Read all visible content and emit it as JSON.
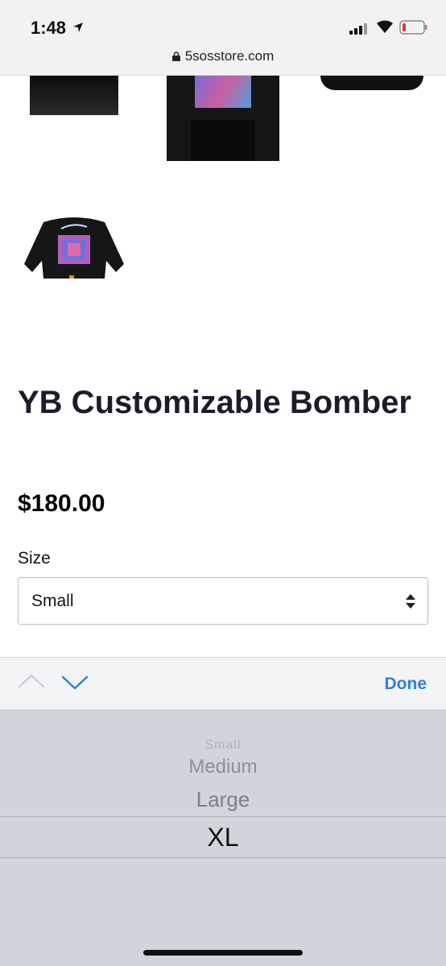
{
  "status_bar": {
    "time": "1:48",
    "url": "5sosstore.com"
  },
  "product": {
    "title": "YB Customizable Bomber",
    "price": "$180.00",
    "size_label": "Size",
    "selected_size": "Small"
  },
  "accessory_bar": {
    "done_label": "Done"
  },
  "picker": {
    "options": [
      "Small",
      "Medium",
      "Large",
      "XL"
    ],
    "highlighted": "XL"
  },
  "colors": {
    "accent": "#2f7fd8",
    "title": "#1c1d2b",
    "picker_bg": "#d1d4da"
  },
  "icons": [
    "location-arrow-icon",
    "signal-icon",
    "wifi-icon",
    "battery-icon",
    "lock-icon",
    "select-arrows-icon",
    "chevron-up-icon",
    "chevron-down-icon"
  ]
}
